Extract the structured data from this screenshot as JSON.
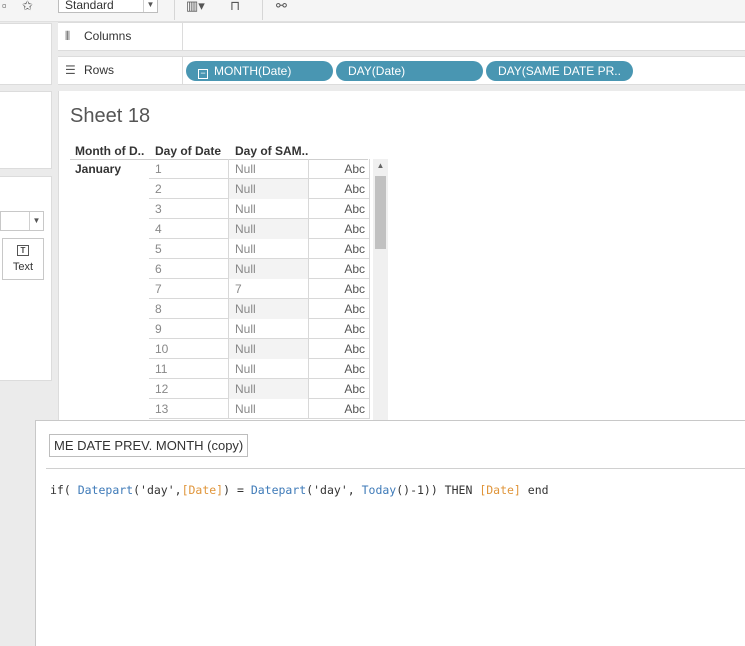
{
  "toolbar": {
    "fit_value": "Standard"
  },
  "shelves": {
    "columns_label": "Columns",
    "rows_label": "Rows",
    "row_pills": [
      "MONTH(Date)",
      "DAY(Date)",
      "DAY(SAME DATE PR.."
    ]
  },
  "marks": {
    "text_label": "Text"
  },
  "sheet": {
    "title": "Sheet 18",
    "headers": [
      "Month of D..",
      "Day of Date",
      "Day of SAM.."
    ],
    "month": "January",
    "rows": [
      {
        "day": "1",
        "same": "Null",
        "abc": "Abc"
      },
      {
        "day": "2",
        "same": "Null",
        "abc": "Abc"
      },
      {
        "day": "3",
        "same": "Null",
        "abc": "Abc"
      },
      {
        "day": "4",
        "same": "Null",
        "abc": "Abc"
      },
      {
        "day": "5",
        "same": "Null",
        "abc": "Abc"
      },
      {
        "day": "6",
        "same": "Null",
        "abc": "Abc"
      },
      {
        "day": "7",
        "same": "7",
        "abc": "Abc"
      },
      {
        "day": "8",
        "same": "Null",
        "abc": "Abc"
      },
      {
        "day": "9",
        "same": "Null",
        "abc": "Abc"
      },
      {
        "day": "10",
        "same": "Null",
        "abc": "Abc"
      },
      {
        "day": "11",
        "same": "Null",
        "abc": "Abc"
      },
      {
        "day": "12",
        "same": "Null",
        "abc": "Abc"
      },
      {
        "day": "13",
        "same": "Null",
        "abc": "Abc"
      }
    ]
  },
  "calc": {
    "name": "ME DATE PREV. MONTH (copy)",
    "formula": {
      "t1": "if( ",
      "t2": "Datepart",
      "t3": "('day',",
      "t4": "[Date]",
      "t5": ") = ",
      "t6": "Datepart",
      "t7": "('day', ",
      "t8": "Today",
      "t9": "()-1)) THEN ",
      "t10": "[Date]",
      "t11": " end"
    }
  },
  "colors": {
    "pill": "#4996b2",
    "function": "#3e7ab8",
    "field": "#e0953a"
  }
}
